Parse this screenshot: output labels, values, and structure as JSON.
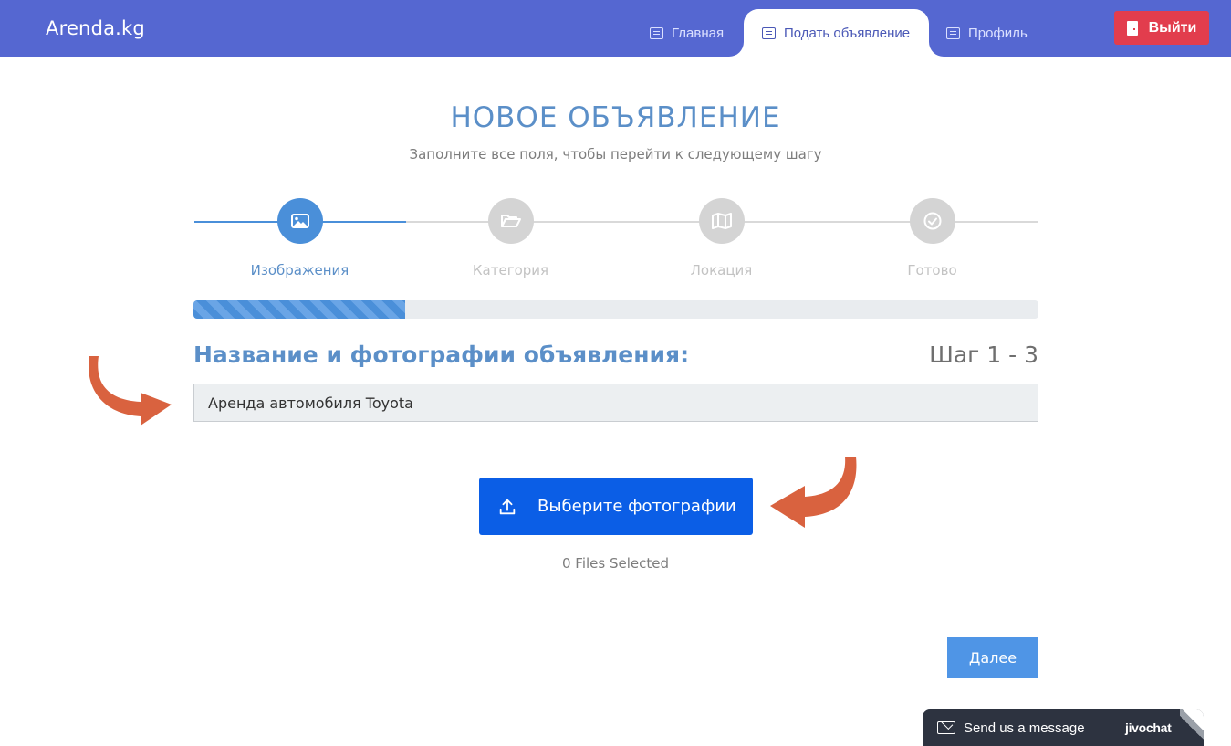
{
  "header": {
    "brand": "Arenda.kg",
    "nav": {
      "home": "Главная",
      "post": "Подать объявление",
      "profile": "Профиль"
    },
    "logout": "Выйти"
  },
  "page": {
    "title": "НОВОЕ ОБЪЯВЛЕНИЕ",
    "subtitle": "Заполните все поля, чтобы перейти к следующему шагу"
  },
  "steps": [
    {
      "label": "Изображения",
      "icon": "image-icon",
      "active": true
    },
    {
      "label": "Категория",
      "icon": "folder-open-icon",
      "active": false
    },
    {
      "label": "Локация",
      "icon": "map-icon",
      "active": false
    },
    {
      "label": "Готово",
      "icon": "check-circle-icon",
      "active": false
    }
  ],
  "progress": {
    "fraction": 0.25
  },
  "form": {
    "section_title": "Название и фотографии объявления:",
    "step_count": "Шаг 1 - 3",
    "title_value": "Аренда автомобиля Toyota",
    "upload_label": "Выберите фотографии",
    "files_selected": "0 Files Selected",
    "next_label": "Далее"
  },
  "chat": {
    "message": "Send us a message",
    "brand": "jivochat"
  },
  "colors": {
    "header": "#5567d1",
    "accent": "#4a8fd9",
    "logout": "#e23d4d",
    "upload": "#0b5ee6",
    "arrow": "#d9623f"
  }
}
